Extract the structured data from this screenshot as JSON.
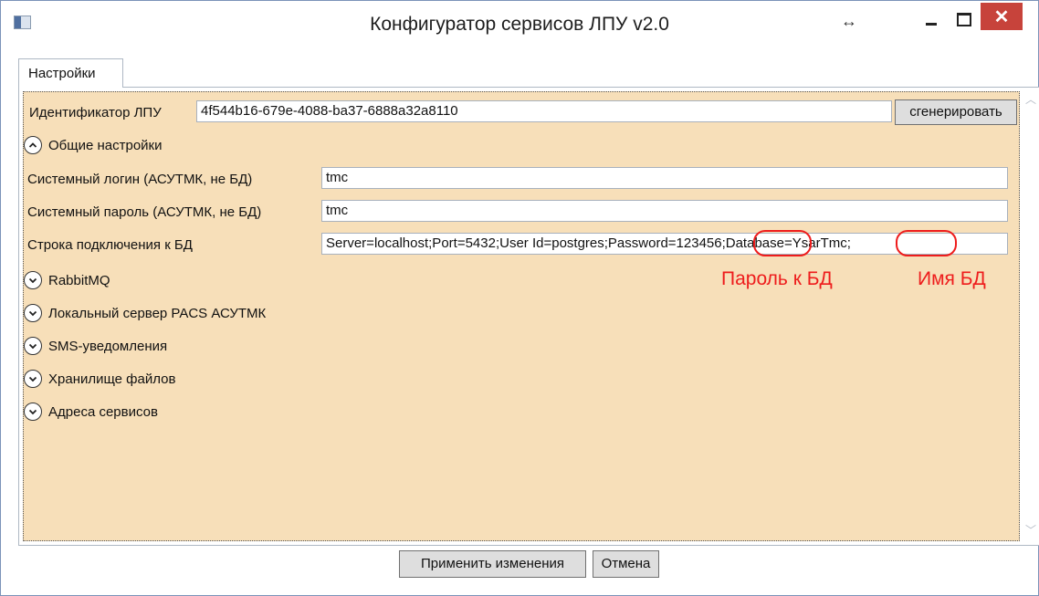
{
  "window": {
    "title": "Конфигуратор сервисов ЛПУ v2.0",
    "resize_indicator": "↔",
    "close_glyph": "✕"
  },
  "tabs": [
    {
      "label": "Настройки"
    }
  ],
  "settings": {
    "lpu_id": {
      "label": "Идентификатор ЛПУ",
      "value": "4f544b16-679e-4088-ba37-6888a32a8110",
      "generate_button": "сгенерировать"
    },
    "sections": [
      {
        "label": "Общие настройки",
        "expanded": true
      },
      {
        "label": "RabbitMQ",
        "expanded": false
      },
      {
        "label": "Локальный сервер PACS АСУТМК",
        "expanded": false
      },
      {
        "label": "SMS-уведомления",
        "expanded": false
      },
      {
        "label": "Хранилище файлов",
        "expanded": false
      },
      {
        "label": "Адреса сервисов",
        "expanded": false
      }
    ],
    "general": {
      "system_login": {
        "label": "Системный логин (АСУТМК, не БД)",
        "value": "tmc"
      },
      "system_password": {
        "label": "Системный пароль (АСУТМК, не БД)",
        "value": "tmc"
      },
      "connection_string": {
        "label": "Строка подключения к БД",
        "value": "Server=localhost;Port=5432;User Id=postgres;Password=123456;Database=YsarTmc;"
      }
    }
  },
  "annotations": {
    "password_label": "Пароль к БД",
    "dbname_label": "Имя БД",
    "color": "#ee1c1c"
  },
  "footer": {
    "apply_button": "Применить изменения",
    "cancel_button": "Отмена"
  },
  "colors": {
    "content_background": "#f7dfb9",
    "close_button": "#c7433b"
  }
}
